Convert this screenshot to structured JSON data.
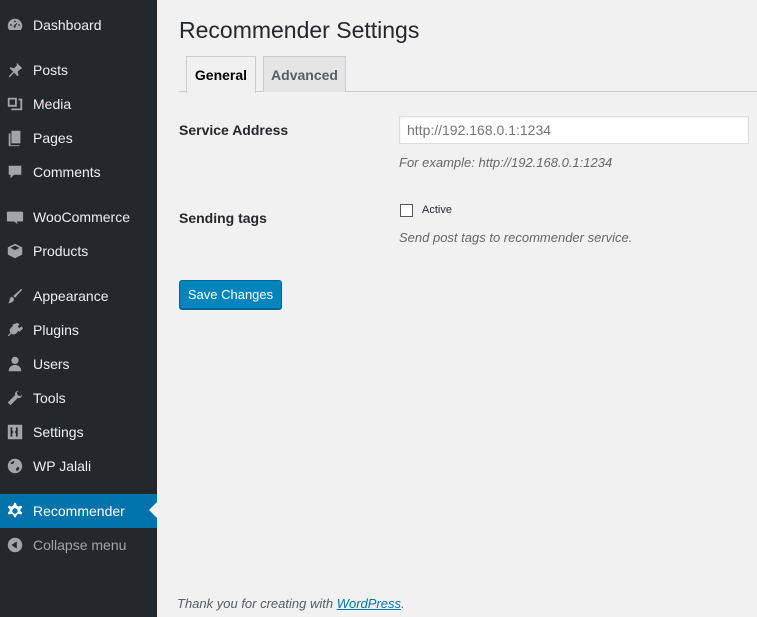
{
  "sidebar": {
    "items": [
      {
        "label": "Dashboard",
        "icon": "dashboard-icon"
      },
      {
        "label": "Posts",
        "icon": "pin-icon"
      },
      {
        "label": "Media",
        "icon": "media-icon"
      },
      {
        "label": "Pages",
        "icon": "pages-icon"
      },
      {
        "label": "Comments",
        "icon": "comment-icon"
      },
      {
        "label": "WooCommerce",
        "icon": "woocommerce-icon"
      },
      {
        "label": "Products",
        "icon": "box-icon"
      },
      {
        "label": "Appearance",
        "icon": "brush-icon"
      },
      {
        "label": "Plugins",
        "icon": "plug-icon"
      },
      {
        "label": "Users",
        "icon": "user-icon"
      },
      {
        "label": "Tools",
        "icon": "wrench-icon"
      },
      {
        "label": "Settings",
        "icon": "sliders-icon"
      },
      {
        "label": "WP Jalali",
        "icon": "globe-icon"
      },
      {
        "label": "Recommender",
        "icon": "gear-icon",
        "active": true
      },
      {
        "label": "Collapse menu",
        "icon": "collapse-icon"
      }
    ]
  },
  "main": {
    "title": "Recommender Settings",
    "tabs": [
      {
        "label": "General",
        "active": true
      },
      {
        "label": "Advanced",
        "active": false
      }
    ],
    "service_address": {
      "label": "Service Address",
      "value": "",
      "placeholder": "http://192.168.0.1:1234",
      "description": "For example: http://192.168.0.1:1234"
    },
    "sending_tags": {
      "label": "Sending tags",
      "checkbox_label": "Active",
      "checked": false,
      "description": "Send post tags to recommender service."
    },
    "save_label": "Save Changes"
  },
  "footer": {
    "text_before": "Thank you for creating with ",
    "link_text": "WordPress",
    "text_after": "."
  },
  "colors": {
    "sidebar_bg": "#23282d",
    "active_bg": "#0073aa",
    "button_bg": "#0085ba",
    "page_bg": "#f1f1f1"
  }
}
